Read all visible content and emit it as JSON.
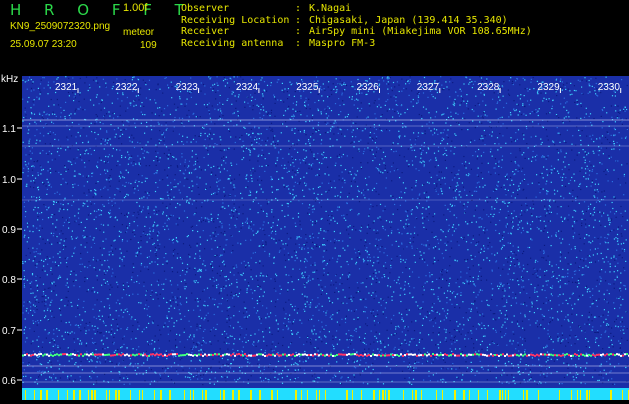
{
  "header": {
    "brand": "H R O F F T",
    "version": "1.00f",
    "filename": "KN9_2509072320.png",
    "datetime": "25.09.07 23:20",
    "meteor_label": "meteor",
    "meteor_count": "109",
    "info": [
      {
        "key": "Observer",
        "value": "K.Nagai"
      },
      {
        "key": "Receiving Location",
        "value": "Chigasaki, Japan (139.414 35.340)"
      },
      {
        "key": "Receiver",
        "value": "AirSpy mini (Miakejima VOR 108.65MHz)"
      },
      {
        "key": "Receiving antenna",
        "value": "Maspro FM-3"
      }
    ]
  },
  "plot": {
    "y_unit": "kHz",
    "y_ticks": [
      "1.1",
      "1.0",
      "0.9",
      "0.8",
      "0.7",
      "0.6"
    ],
    "time_labels": [
      "2321",
      "2322",
      "2323",
      "2324",
      "2325",
      "2326",
      "2327",
      "2328",
      "2329",
      "2330"
    ],
    "colors": {
      "background": "#1a2fa8",
      "noise_light": "#3fd3ff",
      "noise_dark": "#0a1a80",
      "carrier": "#e0e0ff",
      "meteor_band": "#ff3366",
      "bottom_bar": "#22ddff",
      "label": "#ffffff"
    }
  }
}
